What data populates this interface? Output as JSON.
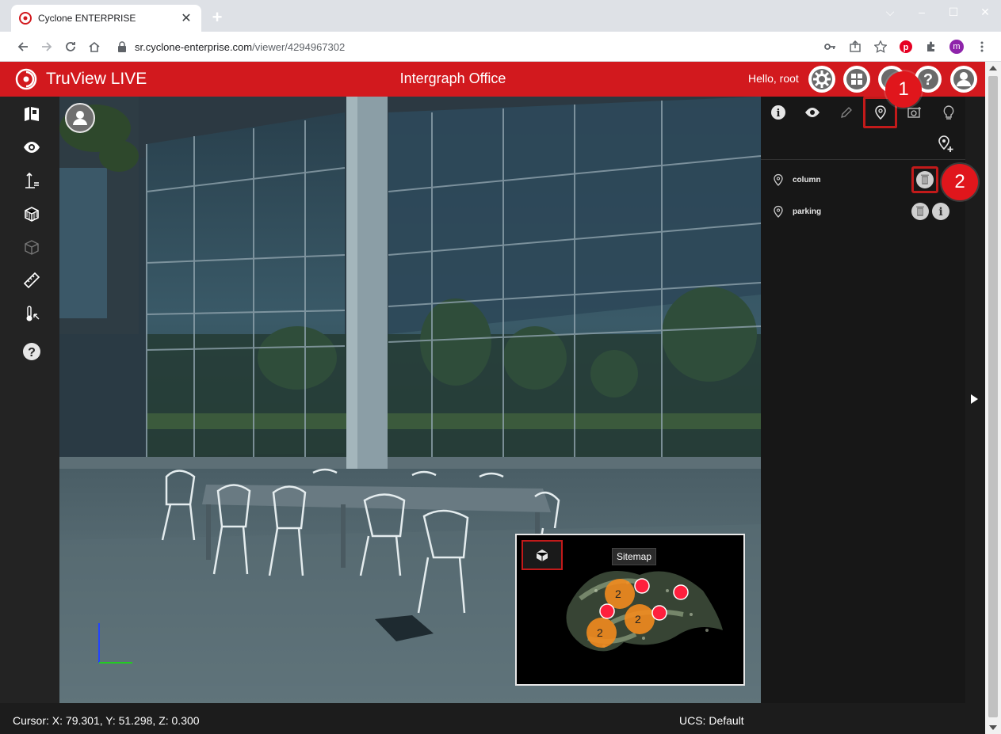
{
  "browser": {
    "tab_title": "Cyclone ENTERPRISE",
    "tab_close": "✕",
    "new_tab": "+",
    "url_host": "sr.cyclone-enterprise.com",
    "url_path": "/viewer/4294967302",
    "profile_initial": "m",
    "window_controls": {
      "dropdown": "⌵",
      "minimize": "–",
      "maximize": "☐",
      "close": "✕"
    }
  },
  "app": {
    "name": "TruView LIVE",
    "title": "Intergraph Office",
    "greeting": "Hello, root",
    "brand_color": "#d2191e",
    "header_buttons": [
      "settings-icon",
      "grid-icon",
      "location-icon",
      "help-icon",
      "user-icon"
    ]
  },
  "left_toolbar": {
    "tools": [
      "sitemap-icon",
      "eye-icon",
      "height-measure-icon",
      "cube-icon",
      "box-outline-icon",
      "ruler-icon",
      "thermometer-icon",
      "help-icon"
    ]
  },
  "right_panel": {
    "tabs": [
      "info-icon",
      "eye-icon",
      "pencil-icon",
      "pin-icon",
      "camera-icon",
      "bulb-icon"
    ],
    "active_tab": "pin-icon",
    "items": [
      {
        "label": "column"
      },
      {
        "label": "parking"
      }
    ]
  },
  "sitemap": {
    "tooltip": "Sitemap",
    "clusters": [
      "2",
      "2",
      "2"
    ]
  },
  "callouts": [
    "1",
    "2"
  ],
  "status": {
    "cursor": "Cursor: X: 79.301, Y: 51.298, Z: 0.300",
    "ucs": "UCS: Default"
  }
}
